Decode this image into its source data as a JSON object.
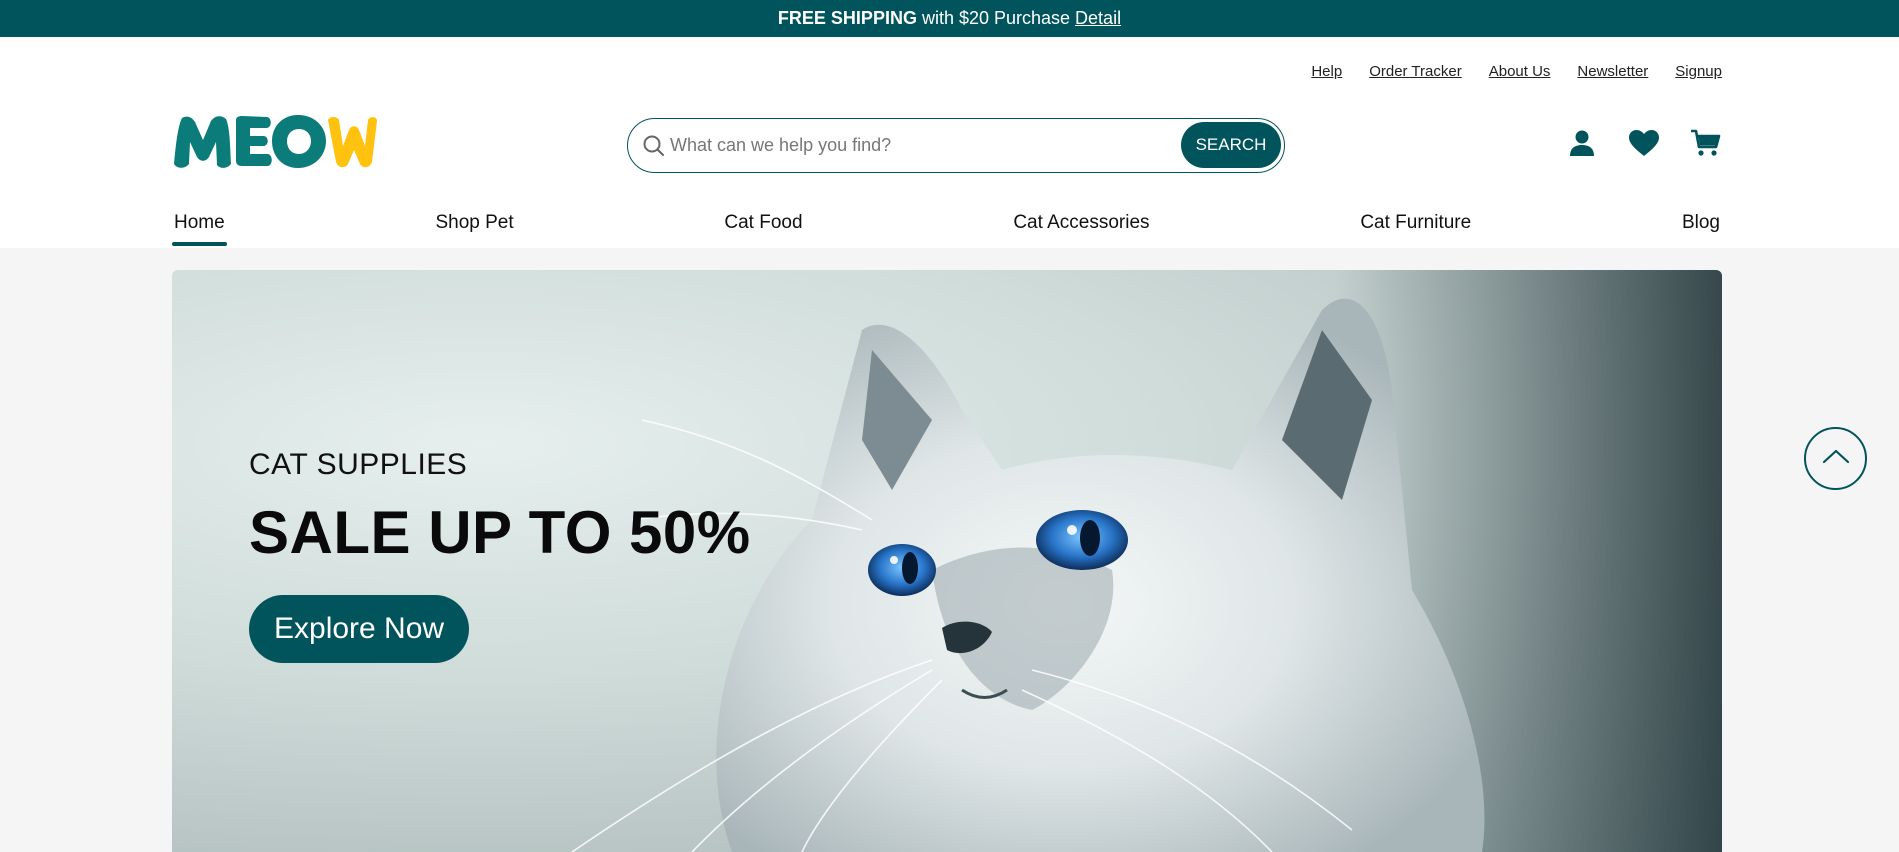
{
  "promo": {
    "bold": "FREE SHIPPING",
    "text": "with $20 Purchase",
    "link": "Detail"
  },
  "top_links": [
    "Help",
    "Order Tracker",
    "About Us",
    "Newsletter",
    "Signup"
  ],
  "logo": {
    "text": "MEOW"
  },
  "search": {
    "placeholder": "What can we help you find?",
    "value": "",
    "button": "SEARCH"
  },
  "icons": {
    "account": "user-icon",
    "wishlist": "heart-icon",
    "cart": "cart-icon"
  },
  "nav": [
    {
      "label": "Home",
      "active": true
    },
    {
      "label": "Shop Pet"
    },
    {
      "label": "Cat Food"
    },
    {
      "label": "Cat Accessories"
    },
    {
      "label": "Cat Furniture"
    },
    {
      "label": "Blog"
    }
  ],
  "hero": {
    "kicker": "CAT SUPPLIES",
    "title": "SALE UP TO 50%",
    "cta": "Explore Now"
  },
  "colors": {
    "brand": "#02545c",
    "logo_teal": "#0b7c7a",
    "logo_yellow": "#ffc20e"
  }
}
